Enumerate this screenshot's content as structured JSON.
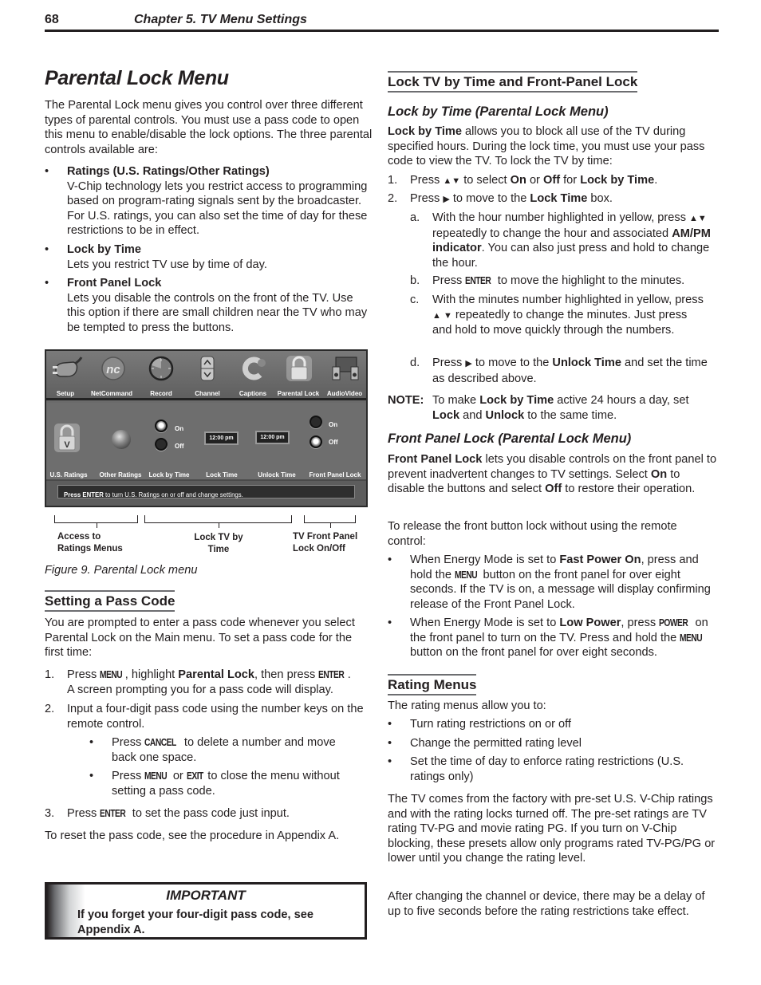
{
  "header": {
    "page_number": "68",
    "chapter_title": "Chapter 5. TV Menu Settings"
  },
  "left": {
    "title": "Parental Lock Menu",
    "intro": "The Parental Lock menu gives you control over three different types of parental controls.  You must use a pass code to open this menu to enable/disable the lock options. The three parental controls available are:",
    "controls": [
      {
        "bullet": "•",
        "name": "Ratings (U.S. Ratings/Other Ratings)",
        "desc": "V-Chip technology lets you restrict access to programming based on program-rating signals sent by the broadcaster.  For U.S. ratings, you can also set the time of day for these restrictions to be in effect."
      },
      {
        "bullet": "•",
        "name": "Lock by Time",
        "desc": "Lets you restrict TV use by time of day."
      },
      {
        "bullet": "•",
        "name": "Front Panel Lock",
        "desc": "Lets you disable the controls on the front of the TV. Use this option if there are small children near the TV who may be tempted to press the buttons."
      }
    ],
    "figure": {
      "top_menu": [
        {
          "label": "Setup",
          "icon": "power-plug-icon"
        },
        {
          "label": "NetCommand",
          "icon": "netcommand-logo-icon"
        },
        {
          "label": "Record",
          "icon": "clock-dial-icon"
        },
        {
          "label": "Channel",
          "icon": "channel-updown-icon"
        },
        {
          "label": "Captions",
          "icon": "captions-c-icon"
        },
        {
          "label": "Parental Lock",
          "icon": "padlock-icon"
        },
        {
          "label": "AudioVideo",
          "icon": "speakers-icon"
        }
      ],
      "settings": {
        "us_ratings": "U.S. Ratings",
        "other_ratings": "Other Ratings",
        "lock_by_time": "Lock by Time",
        "lock_time": "Lock Time",
        "unlock_time": "Unlock Time",
        "front_panel_lock": "Front Panel Lock",
        "on": "On",
        "off": "Off",
        "lock_time_value": "12:00 pm",
        "unlock_time_value": "12:00 pm",
        "lock_by_time_selected": "On",
        "front_panel_lock_selected": "Off"
      },
      "status_bold": "Press ENTER",
      "status_rest": " to turn U.S. Ratings on or off and change settings.",
      "callouts": [
        {
          "line1": "Access to",
          "line2": "Ratings Menus"
        },
        {
          "line1": "Lock TV by",
          "line2": "Time"
        },
        {
          "line1": "TV Front Panel",
          "line2": "Lock On/Off"
        }
      ],
      "caption": "Figure 9.  Parental Lock menu"
    },
    "pass_code": {
      "heading": "Setting a Pass Code",
      "intro": "You are prompted to enter a pass code whenever you select Parental Lock on the Main menu.  To set a pass code for the first time:",
      "step1_num": "1.",
      "step1_a": "Press ",
      "step1_key1": "MENU",
      "step1_b": ", highlight ",
      "step1_bold": "Parental Lock",
      "step1_c": ", then press ",
      "step1_key2": "ENTER",
      "step1_d": ".",
      "step1_line2": "A screen prompting you for a pass code will display.",
      "step2_num": "2.",
      "step2": "Input a four-digit pass code using the number keys on the remote control.",
      "sub1_a": "Press ",
      "sub1_key": "CANCEL",
      "sub1_b": " to delete a number and move back one space.",
      "sub2_a": "Press ",
      "sub2_key1": "MENU",
      "sub2_b": " or ",
      "sub2_key2": "EXIT",
      "sub2_c": " to close the menu without setting a pass code.",
      "step3_num": "3.",
      "step3_a": "Press ",
      "step3_key": "ENTER",
      "step3_b": " to set the pass code just input.",
      "reset": "To reset the pass code, see the procedure in Appendix A."
    },
    "important": {
      "title": "IMPORTANT",
      "body": "If you forget your four-digit pass code, see Appendix A."
    }
  },
  "right": {
    "heading": "Lock TV by Time and Front-Panel Lock",
    "lock_by_time": {
      "subheading": "Lock by Time (Parental Lock Menu)",
      "intro_bold": "Lock by Time",
      "intro_rest": " allows you to block all use of the TV during specified hours.  During the lock time, you must use your pass code to view the TV.  To lock the TV by time:",
      "step1_num": "1.",
      "step1_a": "Press ",
      "step1_arrows": "▲▼",
      "step1_b": " to select ",
      "step1_on": "On",
      "step1_c": " or ",
      "step1_off": "Off",
      "step1_d": " for ",
      "step1_target": "Lock by Time",
      "step1_e": ".",
      "step2_num": "2.",
      "step2_a": "Press ",
      "step2_arrow": "▶",
      "step2_b": " to move to the ",
      "step2_target": "Lock Time",
      "step2_c": " box.",
      "sub_a_letter": "a.",
      "sub_a_1": "With the hour number highlighted in yellow, press ",
      "sub_a_arrows": "▲▼",
      "sub_a_2": " repeatedly to change the hour and associated ",
      "sub_a_bold": "AM/PM indicator",
      "sub_a_3": ".  You can also just press and hold to change the hour.",
      "sub_b_letter": "b.",
      "sub_b_1": "Press ",
      "sub_b_key": "ENTER",
      "sub_b_2": " to move the highlight to the minutes.",
      "sub_c_letter": "c.",
      "sub_c_1": "With the minutes number highlighted in yellow, press ",
      "sub_c_arrows": "▲ ▼",
      "sub_c_2": " repeatedly to change the minutes.  Just press and hold to move quickly through the numbers.",
      "sub_d_letter": "d.",
      "sub_d_1": "Press ",
      "sub_d_arrow": "▶",
      "sub_d_2": " to move to the ",
      "sub_d_bold": "Unlock Time",
      "sub_d_3": " and set the time as described above.",
      "note_label": "NOTE:",
      "note_1": "To make ",
      "note_b1": "Lock by Time",
      "note_2": " active 24 hours a day, set ",
      "note_b2": "Lock",
      "note_3": " and ",
      "note_b3": "Unlock",
      "note_4": " to the same time."
    },
    "front_panel": {
      "subheading": "Front Panel Lock (Parental Lock Menu)",
      "intro_bold": "Front Panel Lock",
      "intro_1": " lets you disable controls on the front panel to prevent inadvertent changes to TV settings. Select ",
      "intro_on": "On",
      "intro_2": " to disable the buttons and select ",
      "intro_off": "Off",
      "intro_3": " to restore their operation.",
      "release": "To release the front button lock without using the remote control:",
      "b1_1": "When Energy Mode is set to ",
      "b1_bold": "Fast Power On",
      "b1_2": ", press and hold the ",
      "b1_key": "MENU",
      "b1_3": " button on the front panel for over eight seconds.  If the TV is on, a message will display confirming release of the Front Panel Lock.",
      "b2_1": "When Energy Mode is set to ",
      "b2_bold": "Low Power",
      "b2_2": ", press ",
      "b2_key1": "POWER",
      "b2_3": " on the front panel to turn on the TV.  Press and hold the ",
      "b2_key2": "MENU",
      "b2_4": " button on the front panel for over eight seconds."
    },
    "rating_menus": {
      "heading": "Rating Menus",
      "intro": "The rating menus allow you to:",
      "bullets": [
        "Turn rating restrictions on or off",
        "Change the permitted rating level",
        "Set the time of day to enforce rating restrictions (U.S. ratings only)"
      ],
      "para1": "The TV comes from the factory with pre-set U.S. V-Chip ratings and with the rating locks turned off.  The pre-set ratings are TV rating TV-PG and movie rating PG.  If you turn on V-Chip blocking, these presets allow only programs rated TV-PG/PG or lower until you change the rating level.",
      "para2": "After changing the channel or device, there may be a delay of up to five seconds before the rating restrictions take effect."
    }
  }
}
